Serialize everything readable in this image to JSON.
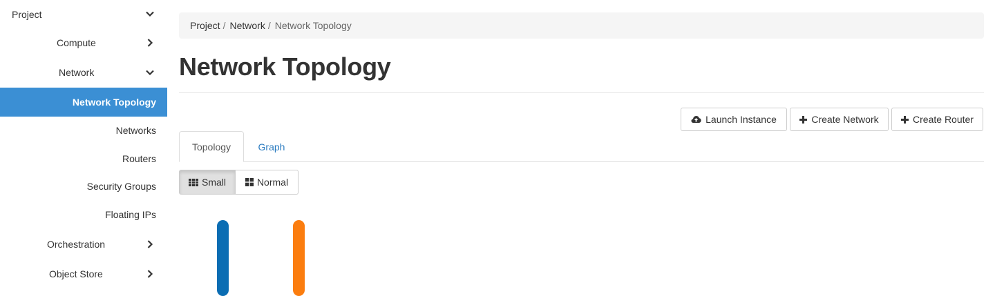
{
  "sidebar": {
    "project": "Project",
    "compute": "Compute",
    "network": "Network",
    "network_topology": "Network Topology",
    "networks": "Networks",
    "routers": "Routers",
    "security_groups": "Security Groups",
    "floating_ips": "Floating IPs",
    "orchestration": "Orchestration",
    "object_store": "Object Store"
  },
  "breadcrumb": {
    "items": [
      "Project",
      "Network",
      "Network Topology"
    ],
    "separator": "/"
  },
  "page": {
    "title": "Network Topology"
  },
  "actions": {
    "launch_instance": "Launch Instance",
    "create_network": "Create Network",
    "create_router": "Create Router"
  },
  "tabs": {
    "topology": "Topology",
    "graph": "Graph"
  },
  "size_toggle": {
    "small": "Small",
    "normal": "Normal",
    "selected": "Small"
  },
  "topology": {
    "network_colors": [
      "#0b6db3",
      "#fb7d0f"
    ]
  },
  "colors": {
    "accent": "#3b8fd4",
    "link": "#2a7bc0"
  }
}
